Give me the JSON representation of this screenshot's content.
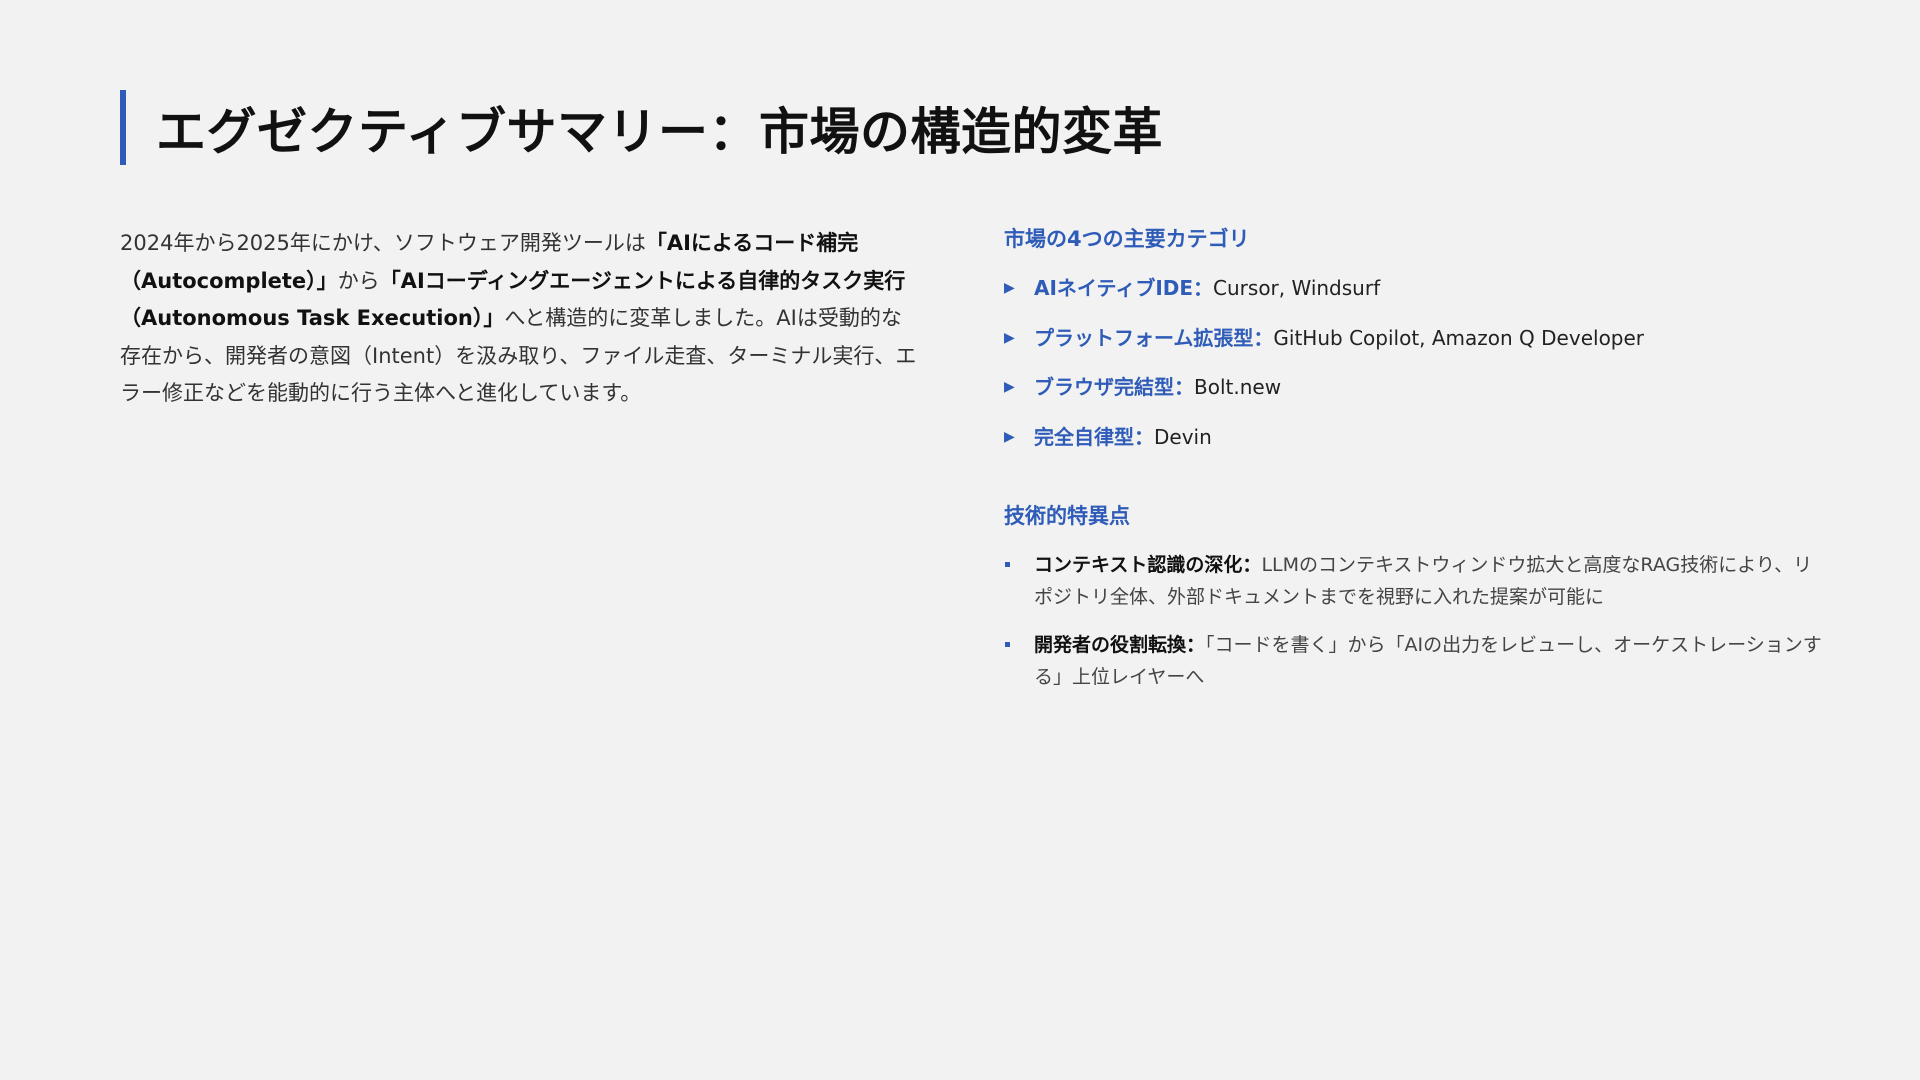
{
  "title": "エグゼクティブサマリー：市場の構造的変革",
  "intro": {
    "p1": "2024年から2025年にかけ、ソフトウェア開発ツールは",
    "b1": "「AIによるコード補完（Autocomplete）」",
    "p2": "から",
    "b2": "「AIコーディングエージェントによる自律的タスク実行（Autonomous Task Execution）」",
    "p3": "へと構造的に変革しました。AIは受動的な存在から、開発者の意図（Intent）を汲み取り、ファイル走査、ターミナル実行、エラー修正などを能動的に行う主体へと進化しています。"
  },
  "categories": {
    "heading": "市場の4つの主要カテゴリ",
    "items": [
      {
        "marker": "▶",
        "label": "AIネイティブIDE：",
        "value": "Cursor, Windsurf"
      },
      {
        "marker": "▶",
        "label": "プラットフォーム拡張型：",
        "value": "GitHub Copilot, Amazon Q Developer"
      },
      {
        "marker": "▶",
        "label": "ブラウザ完結型：",
        "value": "Bolt.new"
      },
      {
        "marker": "▶",
        "label": "完全自律型：",
        "value": "Devin"
      }
    ]
  },
  "tech": {
    "heading": "技術的特異点",
    "items": [
      {
        "label": "コンテキスト認識の深化：",
        "value": "LLMのコンテキストウィンドウ拡大と高度なRAG技術により、リポジトリ全体、外部ドキュメントまでを視野に入れた提案が可能に"
      },
      {
        "label": "開発者の役割転換：",
        "value": "「コードを書く」から「AIの出力をレビューし、オーケストレーションする」上位レイヤーへ"
      }
    ]
  },
  "colors": {
    "accent": "#2e5cb8",
    "background": "#f2f2f2",
    "title": "#111111"
  }
}
